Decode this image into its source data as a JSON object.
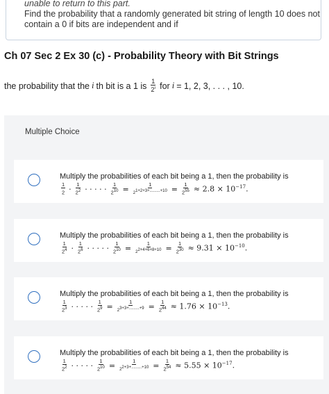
{
  "notice": {
    "line1": "unable to return to this part.",
    "line2": "Find the probability that a randomly generated bit string of length 10 does not",
    "line3": "contain a 0 if bits are independent and if"
  },
  "title": "Ch 07 Sec 2 Ex 30 (c) - Probability Theory with Bit Strings",
  "prompt": {
    "pre": "the probability that the",
    "var_i": "i",
    "mid": "th bit is a 1 is",
    "frac_num": "1",
    "frac_den": "2",
    "frac_den_exp": "i",
    "for": "for",
    "range_var": "i",
    "range": "= 1, 2, 3, . . . , 10."
  },
  "multiple_choice_label": "Multiple Choice",
  "choices": [
    {
      "text": "Multiply the probabilities of each bit being a 1, then the probability is",
      "t1_den": "2",
      "t1_exp": "",
      "t2_den": "2",
      "t2_exp": "2",
      "tn_den": "2",
      "tn_exp": "10",
      "sum_den": "2",
      "sum_exp": "1+2+3+.........+10",
      "res_den": "2",
      "res_exp": "55",
      "approx": "≈ 2.8 × 10",
      "approx_exp": "−17",
      "end": "."
    },
    {
      "text": "Multiply the probabilities of each bit being a 1, then the probability is",
      "t1_den": "2",
      "t1_exp": "4",
      "t2_den": "2",
      "t2_exp": "6",
      "tn_den": "2",
      "tn_exp": "10",
      "sum_den": "2",
      "sum_exp": "2+4+6+8+10",
      "res_den": "2",
      "res_exp": "30",
      "approx": "≈ 9.31 × 10",
      "approx_exp": "−10",
      "end": "."
    },
    {
      "text": "Multiply the probabilities of each bit being a 1, then the probability is",
      "t1_den": "2",
      "t1_exp": "3",
      "t2_den": "",
      "t2_exp": "",
      "tn_den": "2",
      "tn_exp": "9",
      "sum_den": "2",
      "sum_exp": "3+3+.........+9",
      "res_den": "2",
      "res_exp": "44",
      "approx": "≈ 1.76 × 10",
      "approx_exp": "−13",
      "end": "."
    },
    {
      "text": "Multiply the probabilities of each bit being a 1, then the probability is",
      "t1_den": "2",
      "t1_exp": "2",
      "t2_den": "",
      "t2_exp": "",
      "tn_den": "2",
      "tn_exp": "10",
      "sum_den": "2",
      "sum_exp": "2+3+.........+10",
      "res_den": "2",
      "res_exp": "54",
      "approx": "≈ 5.55 × 10",
      "approx_exp": "−17",
      "end": "."
    }
  ],
  "one": "1",
  "dots": "· · · · ·",
  "cdot": "·",
  "equals": "="
}
